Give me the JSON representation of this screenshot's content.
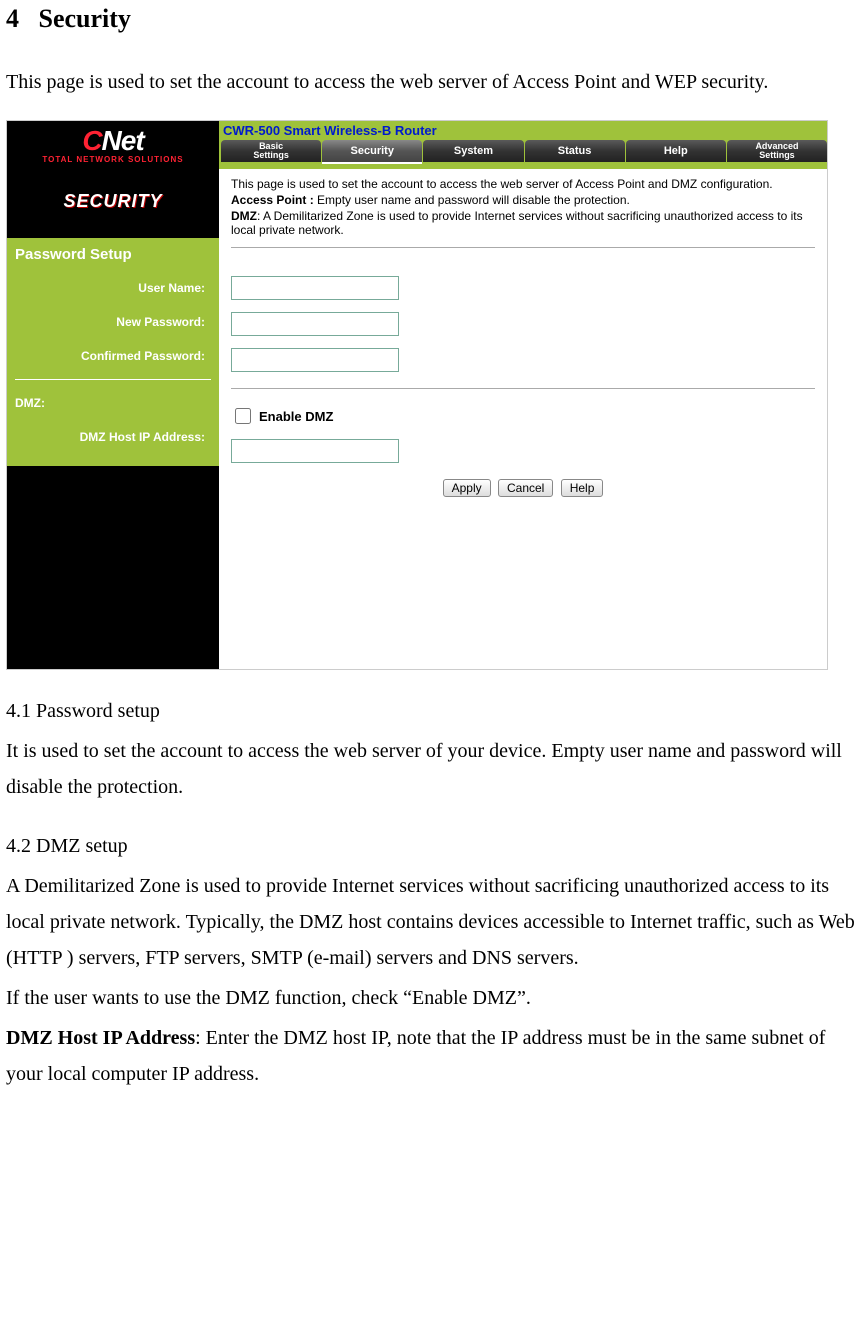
{
  "doc": {
    "section_number": "4",
    "section_title": "Security",
    "intro": "This page is used to set the account to access the web server of Access Point and WEP security.",
    "sub1_num": "4.1 Password setup",
    "sub1_text": "It is used to set the account to access the web server of your device. Empty user name and password will disable the protection.",
    "sub2_num": "4.2 DMZ setup",
    "sub2_text1": "A Demilitarized Zone is used to provide Internet services without sacrificing unauthorized access to its local private network. Typically, the DMZ host contains devices accessible to Internet traffic, such as Web (HTTP ) servers, FTP servers, SMTP (e-mail) servers and DNS servers.",
    "sub2_text2": "If the user wants to use the DMZ function, check “Enable DMZ”.",
    "sub2_label": "DMZ Host IP Address",
    "sub2_text3": ": Enter the DMZ host IP, note that the IP address must be in the same subnet of your local computer IP address."
  },
  "router": {
    "logo_brand_c": "C",
    "logo_brand_rest": "Net",
    "logo_tag": "TOTAL NETWORK SOLUTIONS",
    "model": "CWR-500 Smart Wireless-B Router",
    "tabs": {
      "basic_l1": "Basic",
      "basic_l2": "Settings",
      "security": "Security",
      "system": "System",
      "status": "Status",
      "help": "Help",
      "adv_l1": "Advanced",
      "adv_l2": "Settings"
    },
    "sidebar_title": "SECURITY",
    "sidebar": {
      "pwd_section": "Password Setup",
      "user_name": "User Name:",
      "new_password": "New Password:",
      "confirm_password": "Confirmed Password:",
      "dmz": "DMZ:",
      "dmz_host": "DMZ Host IP Address:"
    },
    "content": {
      "line1": "This page is used to set the account to access the web server of Access Point and DMZ configuration.",
      "ap_label": "Access Point :",
      "ap_text": " Empty user name and password will disable the protection.",
      "dmz_label": "DMZ",
      "dmz_text": ": A Demilitarized Zone is used to provide Internet services without sacrificing unauthorized access to its local private network.",
      "enable_dmz": "Enable DMZ",
      "btn_apply": "Apply",
      "btn_cancel": "Cancel",
      "btn_help": "Help"
    }
  }
}
